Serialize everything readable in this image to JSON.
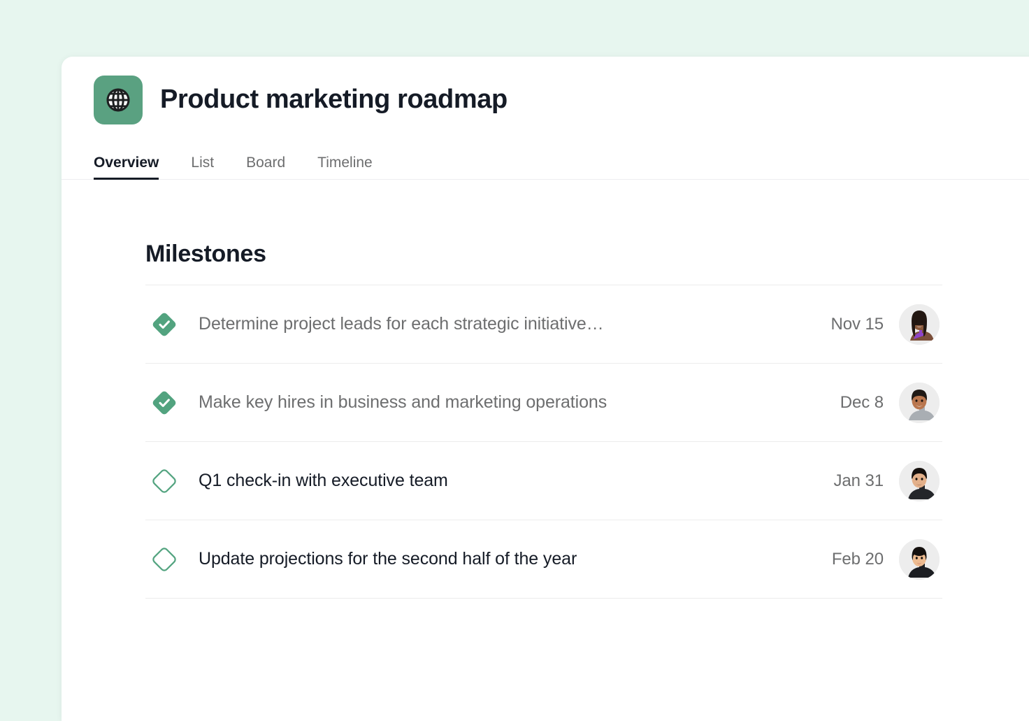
{
  "page": {
    "background_color": "#e7f6ef",
    "card_background": "#ffffff"
  },
  "header": {
    "icon": "globe-icon",
    "icon_background": "#5aa181",
    "title": "Product marketing roadmap"
  },
  "tabs": [
    {
      "label": "Overview",
      "active": true
    },
    {
      "label": "List",
      "active": false
    },
    {
      "label": "Board",
      "active": false
    },
    {
      "label": "Timeline",
      "active": false
    }
  ],
  "milestones_section": {
    "title": "Milestones",
    "accent_color": "#5aa181",
    "rows": [
      {
        "icon": "milestone-complete-icon",
        "status": "complete",
        "name": "Determine project leads for each strategic initiative…",
        "date": "Nov 15",
        "assignee": "avatar-woman-long-hair"
      },
      {
        "icon": "milestone-complete-icon",
        "status": "complete",
        "name": "Make key hires in business and marketing operations",
        "date": "Dec 8",
        "assignee": "avatar-man-short-hair"
      },
      {
        "icon": "milestone-incomplete-icon",
        "status": "incomplete",
        "name": "Q1 check-in with executive team",
        "date": "Jan 31",
        "assignee": "avatar-man-dark-hair"
      },
      {
        "icon": "milestone-incomplete-icon",
        "status": "incomplete",
        "name": "Update projections for the second half of the year",
        "date": "Feb 20",
        "assignee": "avatar-woman-short-hair"
      }
    ]
  }
}
